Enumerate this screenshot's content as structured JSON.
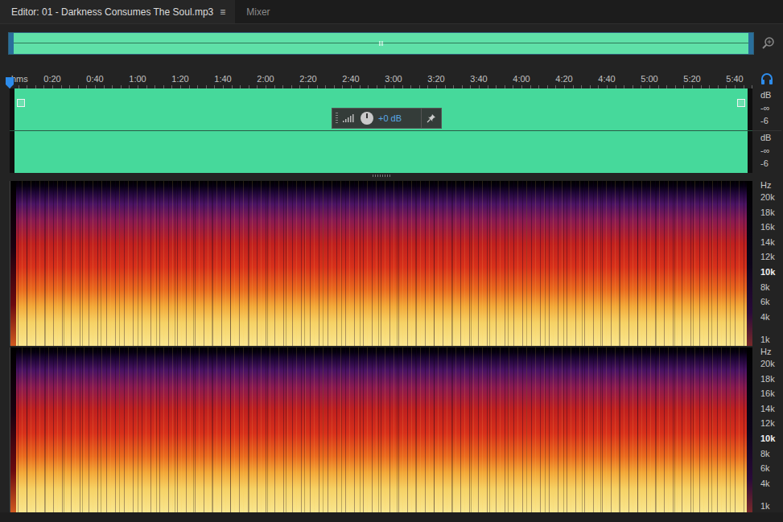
{
  "tabs": [
    {
      "label": "Editor: 01 - Darkness Consumes The Soul.mp3",
      "selected": true,
      "menu": "≡"
    },
    {
      "label": "Mixer",
      "selected": false
    }
  ],
  "playhead": {
    "level": 0
  },
  "ruler": {
    "ticks": [
      "hms",
      "0:20",
      "0:40",
      "1:00",
      "1:20",
      "1:40",
      "2:00",
      "2:20",
      "2:40",
      "3:00",
      "3:20",
      "3:40",
      "4:00",
      "4:20",
      "4:40",
      "5:00",
      "5:20",
      "5:40"
    ]
  },
  "waveform": {
    "gain_hud": {
      "reading": "+0 dB",
      "level": 0.5
    },
    "channels": [
      {
        "scale": [
          "dB",
          "-∞",
          "-6"
        ]
      },
      {
        "scale": [
          "dB",
          "-∞",
          "-6"
        ]
      }
    ]
  },
  "spectrogram": {
    "channels": [
      {
        "scale": [
          {
            "label": "Hz",
            "bold": false
          },
          {
            "label": "20k",
            "bold": false
          },
          {
            "label": "18k",
            "bold": false
          },
          {
            "label": "16k",
            "bold": false
          },
          {
            "label": "14k",
            "bold": false
          },
          {
            "label": "12k",
            "bold": false
          },
          {
            "label": "10k",
            "bold": true
          },
          {
            "label": "8k",
            "bold": false
          },
          {
            "label": "6k",
            "bold": false
          },
          {
            "label": "4k",
            "bold": false
          },
          {
            "label": "1k",
            "bold": false
          }
        ]
      },
      {
        "scale": [
          {
            "label": "Hz",
            "bold": false
          },
          {
            "label": "20k",
            "bold": false
          },
          {
            "label": "18k",
            "bold": false
          },
          {
            "label": "16k",
            "bold": false
          },
          {
            "label": "14k",
            "bold": false
          },
          {
            "label": "12k",
            "bold": false
          },
          {
            "label": "10k",
            "bold": true
          },
          {
            "label": "8k",
            "bold": false
          },
          {
            "label": "6k",
            "bold": false
          },
          {
            "label": "4k",
            "bold": false
          },
          {
            "label": "1k",
            "bold": false
          }
        ]
      }
    ]
  }
}
